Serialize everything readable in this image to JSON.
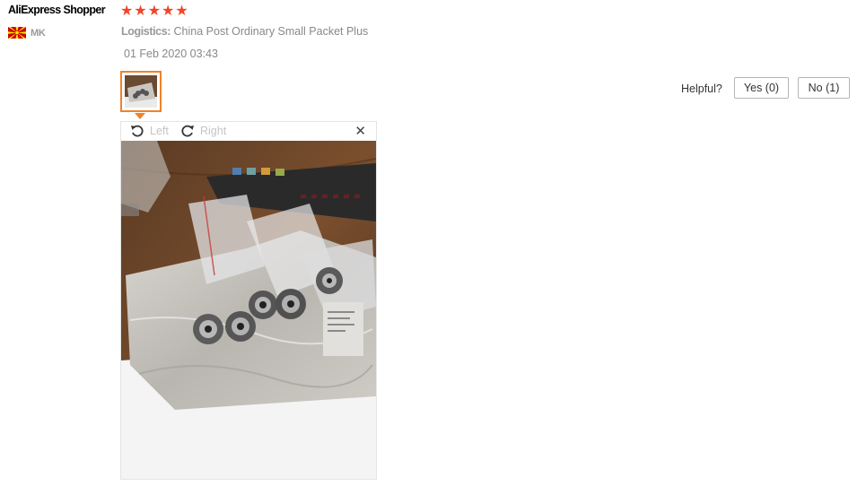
{
  "review": {
    "user_name": "AliExpress Shopper",
    "rating": 5,
    "stars": [
      "★",
      "★",
      "★",
      "★",
      "★"
    ],
    "country_code": "MK",
    "logistics_label": "Logistics:",
    "logistics_value": "China Post Ordinary Small Packet Plus",
    "date": "01 Feb 2020 03:43"
  },
  "helpful": {
    "label": "Helpful?",
    "yes_label": "Yes (0)",
    "no_label": "No (1)"
  },
  "viewer": {
    "rotate_left_label": "Left",
    "rotate_right_label": "Right",
    "close_glyph": "✕"
  },
  "colors": {
    "star": "#f0462a",
    "thumb_border": "#f0822a",
    "flag_red": "#d20000",
    "flag_yellow": "#ffe600"
  }
}
